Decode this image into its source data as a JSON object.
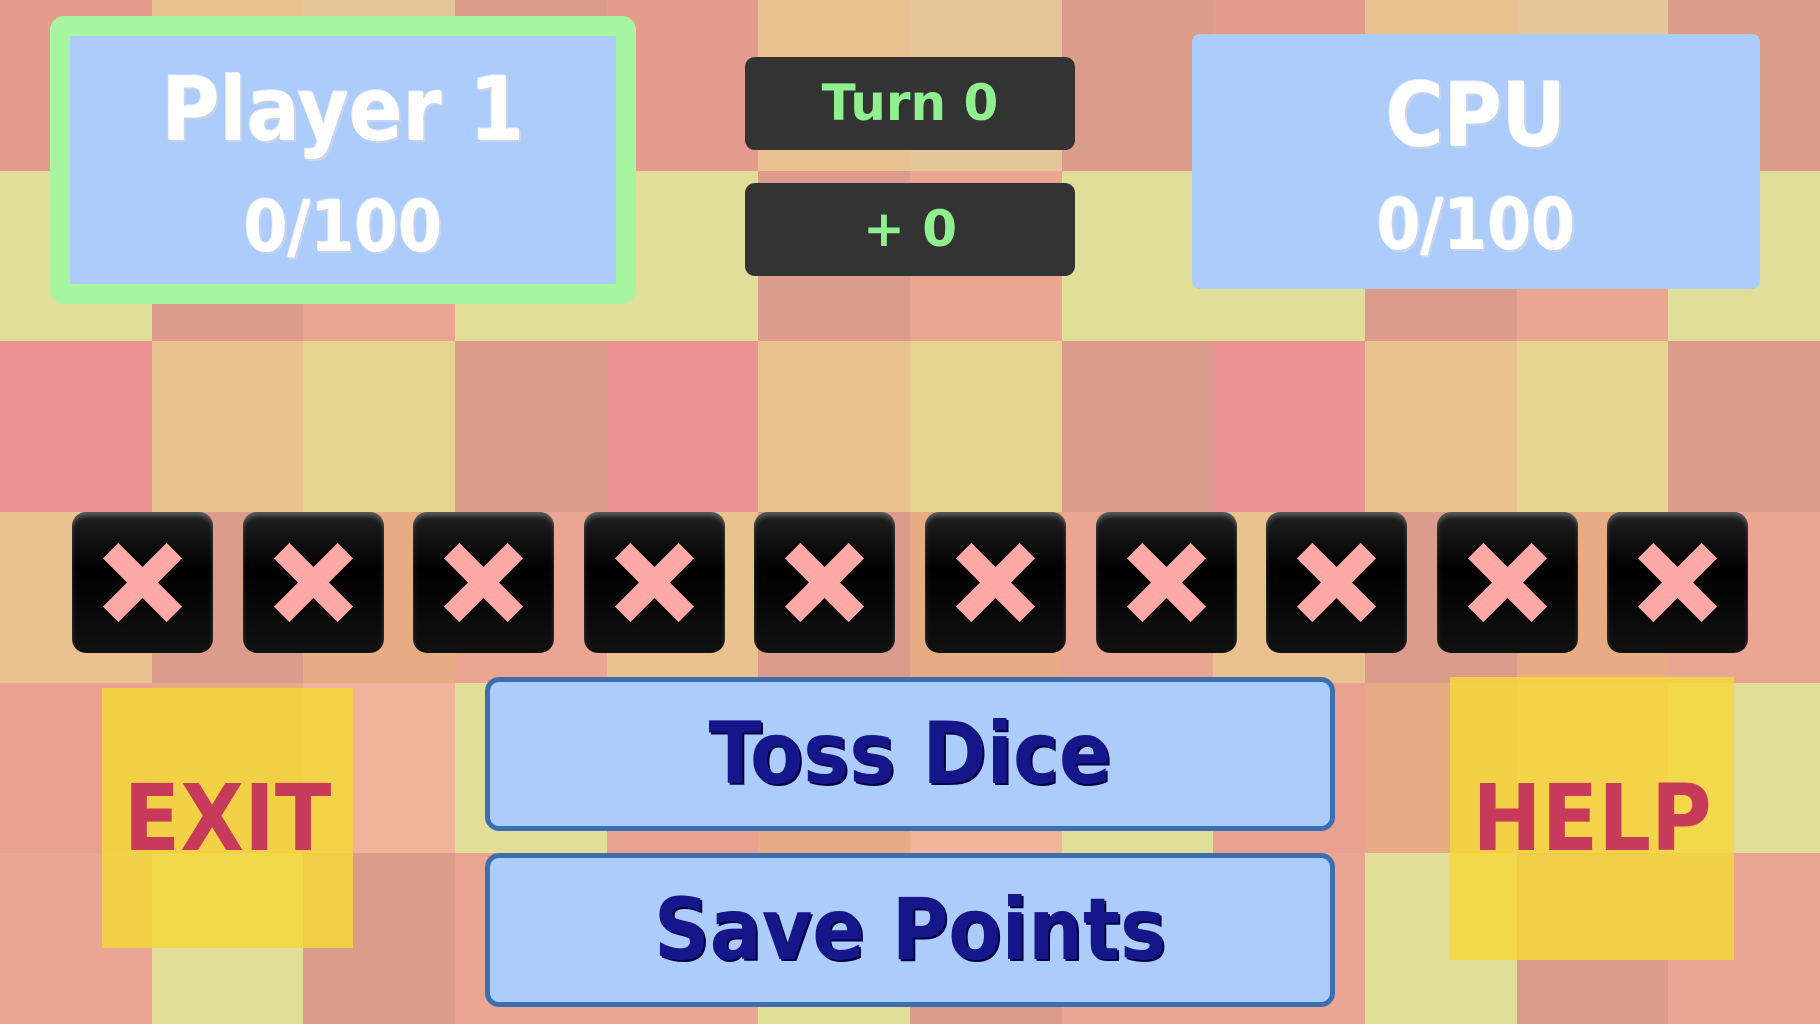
{
  "player": {
    "name": "Player 1",
    "score": "0/100",
    "active_border_color": "#a7f5a0"
  },
  "cpu": {
    "name": "CPU",
    "score": "0/100"
  },
  "turn": {
    "label": "Turn 0"
  },
  "round_points": {
    "label": "+ 0"
  },
  "dice": [
    {
      "state": "x"
    },
    {
      "state": "x"
    },
    {
      "state": "x"
    },
    {
      "state": "x"
    },
    {
      "state": "x"
    },
    {
      "state": "x"
    },
    {
      "state": "x"
    },
    {
      "state": "x"
    },
    {
      "state": "x"
    },
    {
      "state": "x"
    }
  ],
  "buttons": {
    "toss": "Toss Dice",
    "save": "Save Points",
    "exit": "EXIT",
    "help": "HELP"
  },
  "colors": {
    "panel": "#acccfb",
    "dark_panel": "#333333",
    "green_text": "#90f090",
    "x_mark": "#ffa8a8",
    "button_text": "#14168a",
    "side_text": "#c73a5a",
    "side_bg": "#f5d73c"
  }
}
